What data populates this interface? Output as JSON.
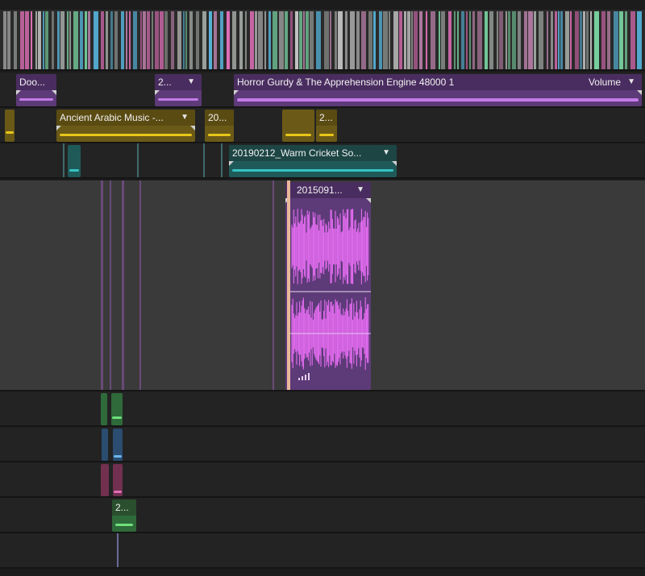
{
  "colors": {
    "purple": "#c47be8",
    "yellow": "#e7c61a",
    "teal": "#36c3c3",
    "green": "#6ee07d",
    "pink": "#e06fb8",
    "background": "#1c1c1c"
  },
  "top_strip": {
    "stripe_colors": [
      "#e06fb8",
      "#7ad6a3",
      "#9fa5a0",
      "#c9c9c9",
      "#b07aa0",
      "#58b8e0"
    ]
  },
  "track_a1": {
    "clip_door": {
      "title": "Doo..."
    },
    "clip_2": {
      "title": "2..."
    },
    "clip_horror": {
      "title": "Horror Gurdy & The Apprehension Engine 48000 1",
      "param": "Volume"
    }
  },
  "track_a2": {
    "clip_arabic": {
      "title": "Ancient Arabic Music -..."
    },
    "clip_20": {
      "title": "20..."
    },
    "clip_2b": {
      "title": "2..."
    }
  },
  "track_a3": {
    "clip_cricket": {
      "title": "20190212_Warm Cricket So..."
    }
  },
  "track_a4": {
    "clip_2015": {
      "title": "2015091..."
    }
  },
  "track_a7": {
    "clip_2c": {
      "title": "2..."
    }
  },
  "icons": {
    "chevron": "chevron-down-icon",
    "signal": "signal-bars-icon"
  }
}
